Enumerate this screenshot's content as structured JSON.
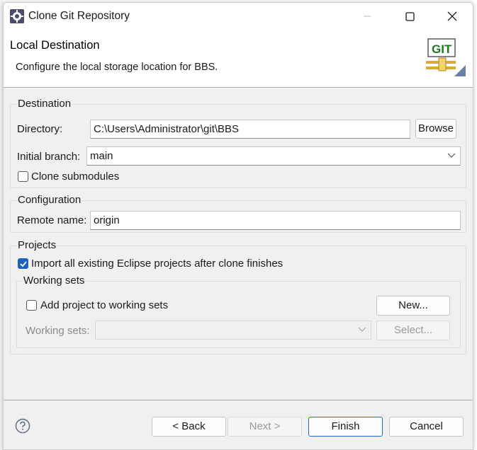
{
  "window": {
    "title": "Clone Git Repository"
  },
  "banner": {
    "title": "Local Destination",
    "description": "Configure the local storage location for BBS.",
    "image_text": "GIT"
  },
  "destination": {
    "group_label": "Destination",
    "directory_label": "Directory:",
    "directory_value": "C:\\Users\\Administrator\\git\\BBS",
    "browse_label": "Browse",
    "initial_branch_label": "Initial branch:",
    "initial_branch_value": "main",
    "clone_submodules_label": "Clone submodules",
    "clone_submodules_checked": false
  },
  "configuration": {
    "group_label": "Configuration",
    "remote_name_label": "Remote name:",
    "remote_name_value": "origin"
  },
  "projects": {
    "group_label": "Projects",
    "import_label": "Import all existing Eclipse projects after clone finishes",
    "import_checked": true,
    "working_sets": {
      "group_label": "Working sets",
      "add_label": "Add project to working sets",
      "add_checked": false,
      "new_label": "New...",
      "working_sets_label": "Working sets:",
      "working_sets_value": "",
      "select_label": "Select..."
    }
  },
  "footer": {
    "back_label": "< Back",
    "next_label": "Next >",
    "finish_label": "Finish",
    "cancel_label": "Cancel"
  },
  "colors": {
    "accent": "#1f5fc4",
    "content_bg": "#f0f0f0",
    "border": "#dcdcdc"
  }
}
